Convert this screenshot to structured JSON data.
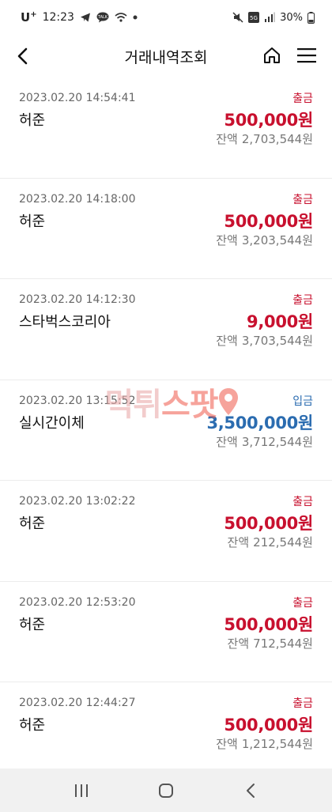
{
  "status_bar": {
    "carrier": "U",
    "carrier_sup": "+",
    "time": "12:23",
    "battery": "30%",
    "network": "5G"
  },
  "header": {
    "title": "거래내역조회"
  },
  "transactions": [
    {
      "date": "2023.02.20 14:54:41",
      "name": "허준",
      "type": "출금",
      "amount": "500,000원",
      "balance_label": "잔액",
      "balance": "2,703,544원"
    },
    {
      "date": "2023.02.20 14:18:00",
      "name": "허준",
      "type": "출금",
      "amount": "500,000원",
      "balance_label": "잔액",
      "balance": "3,203,544원"
    },
    {
      "date": "2023.02.20 14:12:30",
      "name": "스타벅스코리아",
      "type": "출금",
      "amount": "9,000원",
      "balance_label": "잔액",
      "balance": "3,703,544원"
    },
    {
      "date": "2023.02.20 13:15:52",
      "name": "실시간이체",
      "type": "입금",
      "amount": "3,500,000원",
      "balance_label": "잔액",
      "balance": "3,712,544원"
    },
    {
      "date": "2023.02.20 13:02:22",
      "name": "허준",
      "type": "출금",
      "amount": "500,000원",
      "balance_label": "잔액",
      "balance": "212,544원"
    },
    {
      "date": "2023.02.20 12:53:20",
      "name": "허준",
      "type": "출금",
      "amount": "500,000원",
      "balance_label": "잔액",
      "balance": "712,544원"
    },
    {
      "date": "2023.02.20 12:44:27",
      "name": "허준",
      "type": "출금",
      "amount": "500,000원",
      "balance_label": "잔액",
      "balance": "1,212,544원"
    }
  ],
  "watermark": {
    "part1": "먹튀",
    "part2": "스팟"
  },
  "colors": {
    "withdraw": "#c8102e",
    "deposit": "#2b6cb0",
    "muted": "#777777"
  }
}
